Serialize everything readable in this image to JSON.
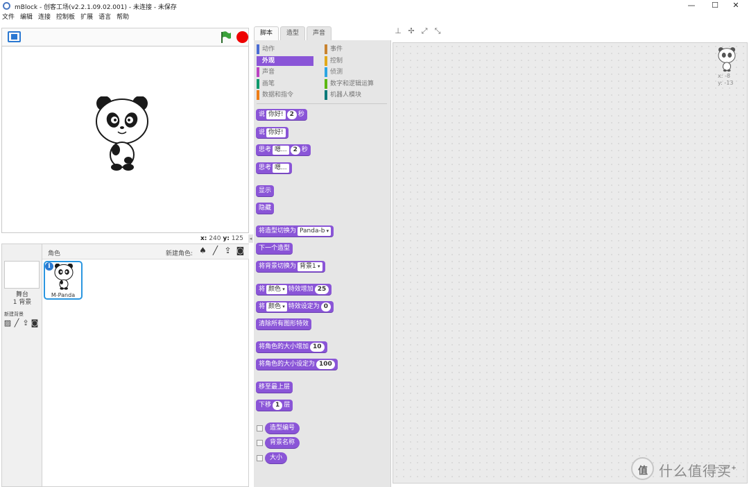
{
  "window": {
    "title": "mBlock - 创客工场(v2.2.1.09.02.001) - 未连接 - 未保存",
    "minimize": "—",
    "maximize": "☐",
    "close": "✕"
  },
  "menu": [
    "文件",
    "编辑",
    "连接",
    "控制板",
    "扩展",
    "语言",
    "帮助"
  ],
  "stage": {
    "coords_x_label": "x:",
    "coords_x": "240",
    "coords_y_label": "y:",
    "coords_y": "125",
    "flag_color": "#2a8a2a",
    "stop_color": "#e00000"
  },
  "sprite_pane": {
    "header_label": "角色",
    "new_sprite_label": "新建角色:",
    "stage_label": "舞台",
    "backdrop_count": "1 背景",
    "new_backdrop_label": "新建背景",
    "sprites": [
      {
        "name": "M-Panda",
        "info": "i"
      }
    ]
  },
  "tabs": [
    {
      "label": "脚本",
      "active": true
    },
    {
      "label": "造型",
      "active": false
    },
    {
      "label": "声音",
      "active": false
    }
  ],
  "categories": [
    {
      "label": "动作",
      "color": "#4a6cd4"
    },
    {
      "label": "事件",
      "color": "#c88330"
    },
    {
      "label": "外观",
      "color": "#8a55d7"
    },
    {
      "label": "控制",
      "color": "#e1a91a"
    },
    {
      "label": "声音",
      "color": "#bb42c3"
    },
    {
      "label": "侦测",
      "color": "#2ca5e2"
    },
    {
      "label": "画笔",
      "color": "#0e9a6c"
    },
    {
      "label": "数字和逻辑运算",
      "color": "#5cb712"
    },
    {
      "label": "数据和指令",
      "color": "#ee7d16"
    },
    {
      "label": "机器人模块",
      "color": "#0c7a7a"
    }
  ],
  "blocks": {
    "say_secs": {
      "pre": "说",
      "text": "你好!",
      "num": "2",
      "post": "秒"
    },
    "say": {
      "pre": "说",
      "text": "你好!"
    },
    "think_secs": {
      "pre": "思考",
      "text": "嗯...",
      "num": "2",
      "post": "秒"
    },
    "think": {
      "pre": "思考",
      "text": "嗯..."
    },
    "show": "显示",
    "hide": "隐藏",
    "switch_costume": {
      "pre": "将造型切换为",
      "value": "Panda-b"
    },
    "next_costume": "下一个造型",
    "switch_backdrop": {
      "pre": "将背景切换为",
      "value": "背景1"
    },
    "change_effect": {
      "pre": "将",
      "effect": "颜色",
      "mid": "特效增加",
      "num": "25"
    },
    "set_effect": {
      "pre": "将",
      "effect": "颜色",
      "mid": "特效设定为",
      "num": "0"
    },
    "clear_effects": "清除所有图形特效",
    "change_size": {
      "pre": "将角色的大小增加",
      "num": "10"
    },
    "set_size": {
      "pre": "将角色的大小设定为",
      "num": "100"
    },
    "go_front": "移至最上层",
    "go_back": {
      "pre": "下移",
      "num": "1",
      "post": "层"
    },
    "reporters": [
      "造型编号",
      "背景名称",
      "大小"
    ]
  },
  "script_area": {
    "sprite_x": "x: -8",
    "sprite_y": "y: -13",
    "zoom_out": "−",
    "zoom_reset": "=",
    "zoom_in": "+"
  },
  "watermark": {
    "logo": "值",
    "text": "什么值得买"
  }
}
